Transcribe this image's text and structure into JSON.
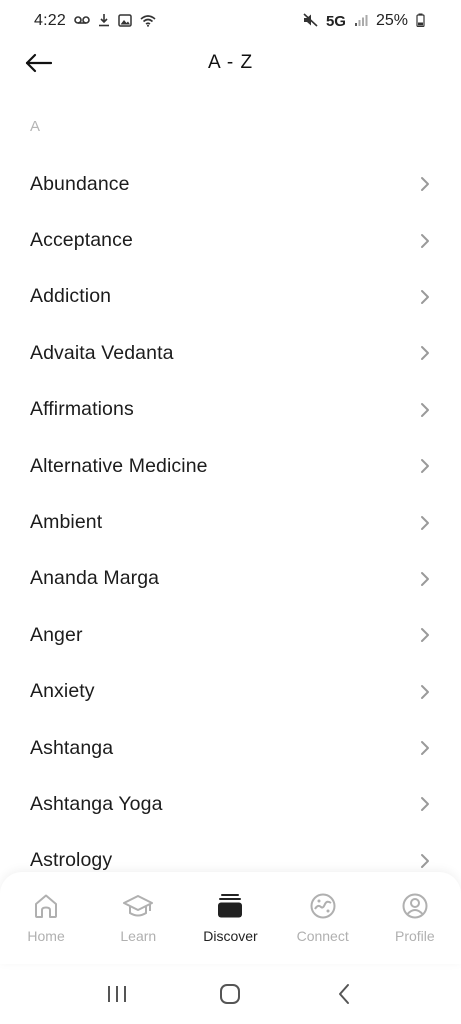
{
  "status_bar": {
    "time": "4:22",
    "network": "5G",
    "battery": "25%"
  },
  "header": {
    "title": "A - Z"
  },
  "section": {
    "letter": "A"
  },
  "items": [
    {
      "label": "Abundance"
    },
    {
      "label": "Acceptance"
    },
    {
      "label": "Addiction"
    },
    {
      "label": "Advaita Vedanta"
    },
    {
      "label": "Affirmations"
    },
    {
      "label": "Alternative Medicine"
    },
    {
      "label": "Ambient"
    },
    {
      "label": "Ananda Marga"
    },
    {
      "label": "Anger"
    },
    {
      "label": "Anxiety"
    },
    {
      "label": "Ashtanga"
    },
    {
      "label": "Ashtanga Yoga"
    },
    {
      "label": "Astrology"
    }
  ],
  "bottom_nav": {
    "items": [
      {
        "label": "Home",
        "icon": "home-icon"
      },
      {
        "label": "Learn",
        "icon": "graduation-cap-icon"
      },
      {
        "label": "Discover",
        "icon": "stack-icon",
        "active": true
      },
      {
        "label": "Connect",
        "icon": "globe-icon"
      },
      {
        "label": "Profile",
        "icon": "profile-icon"
      }
    ]
  },
  "colors": {
    "text": "#1c1c1c",
    "muted": "#b0b0b0",
    "chevron": "#9a9a9a",
    "active": "#222222"
  }
}
